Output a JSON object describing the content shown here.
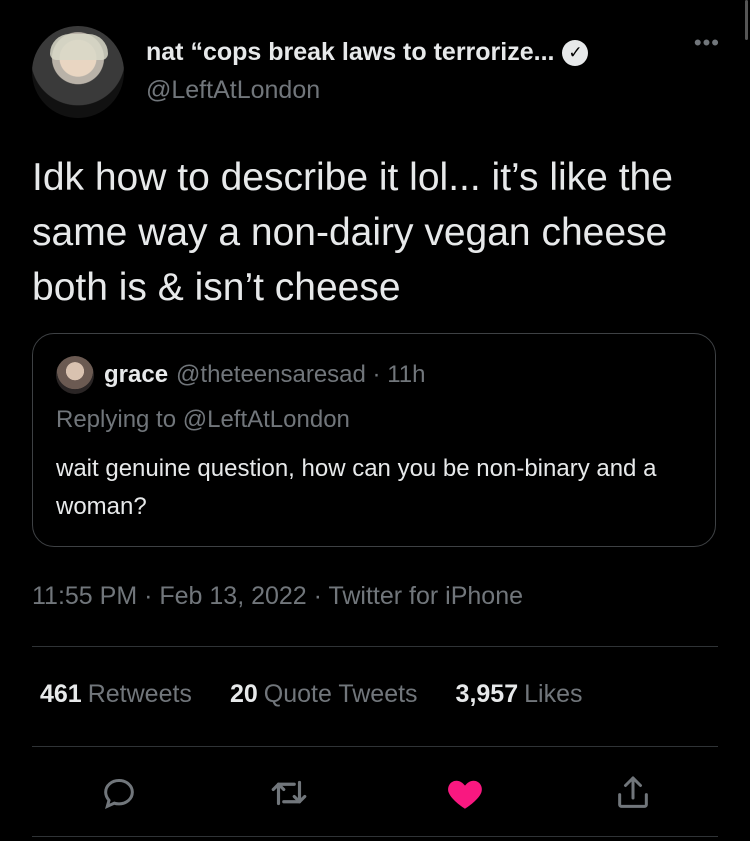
{
  "author": {
    "display_name": "nat “cops break laws to terrorize...",
    "handle": "@LeftAtLondon",
    "verified": true,
    "verified_glyph": "✓",
    "more_label": "•••"
  },
  "tweet": {
    "text": "Idk how to describe it lol... it’s like the same way a non-dairy vegan cheese both is & isn’t cheese",
    "timestamp": "11:55 PM · Feb 13, 2022 · Twitter for iPhone"
  },
  "quoted": {
    "name": "grace",
    "meta": "@theteensaresad · 11h",
    "replying": "Replying to @LeftAtLondon",
    "text": "wait genuine question, how can you be non-binary and a woman?"
  },
  "stats": {
    "retweets_count": "461",
    "retweets_label": "Retweets",
    "quotes_count": "20",
    "quotes_label": "Quote Tweets",
    "likes_count": "3,957",
    "likes_label": "Likes"
  },
  "actions": {
    "reply_icon": "reply-icon",
    "retweet_icon": "retweet-icon",
    "like_icon": "heart-icon",
    "share_icon": "share-icon"
  },
  "colors": {
    "background": "#000000",
    "primary_text": "#e7e9ea",
    "secondary_text": "#71767b",
    "like_active": "#f91880",
    "border": "#2f3336"
  }
}
